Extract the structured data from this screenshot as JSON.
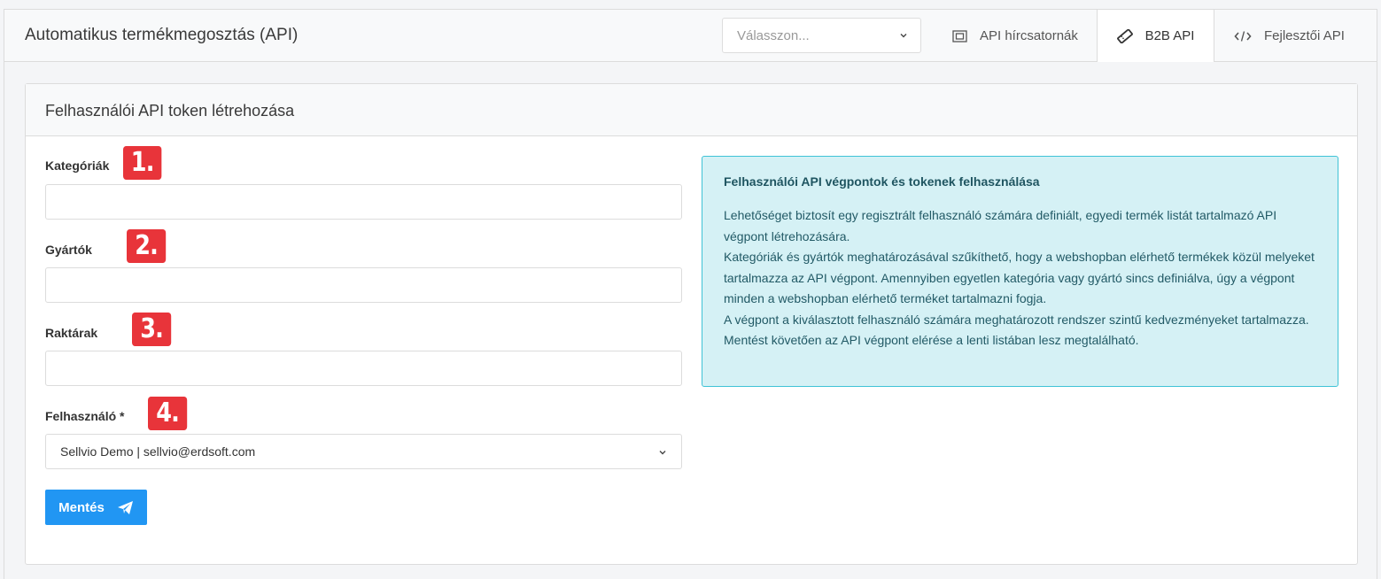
{
  "header": {
    "title": "Automatikus termékmegosztás (API)",
    "select_placeholder": "Válasszon...",
    "tabs": [
      {
        "label": "API hírcsatornák",
        "icon": "expand-icon"
      },
      {
        "label": "B2B API",
        "icon": "ticket-icon",
        "active": true
      },
      {
        "label": "Fejlesztői API",
        "icon": "code-icon"
      }
    ]
  },
  "card": {
    "title": "Felhasználói API token létrehozása"
  },
  "form": {
    "categories_label": "Kategóriák",
    "manufacturers_label": "Gyártók",
    "warehouses_label": "Raktárak",
    "user_label": "Felhasználó *",
    "user_value": "Sellvio Demo | sellvio@erdsoft.com",
    "save_label": "Mentés",
    "badges": [
      "1.",
      "2.",
      "3.",
      "4."
    ]
  },
  "info": {
    "title": "Felhasználói API végpontok és tokenek felhasználása",
    "paragraphs": [
      "Lehetőséget biztosít egy regisztrált felhasználó számára definiált, egyedi termék listát tartalmazó API végpont létrehozására.",
      "Kategóriák és gyártók meghatározásával szűkíthető, hogy a webshopban elérhető termékek közül melyeket tartalmazza az API végpont. Amennyiben egyetlen kategória vagy gyártó sincs definiálva, úgy a végpont minden a webshopban elérhető terméket tartalmazni fogja.",
      "A végpont a kiválasztott felhasználó számára meghatározott rendszer szintű kedvezményeket tartalmazza.",
      "Mentést követően az API végpont elérése a lenti listában lesz megtalálható."
    ]
  },
  "colors": {
    "accent": "#2196f3",
    "badge": "#e8343a",
    "info_bg": "#d5f1f5",
    "info_border": "#3fc3d6"
  }
}
